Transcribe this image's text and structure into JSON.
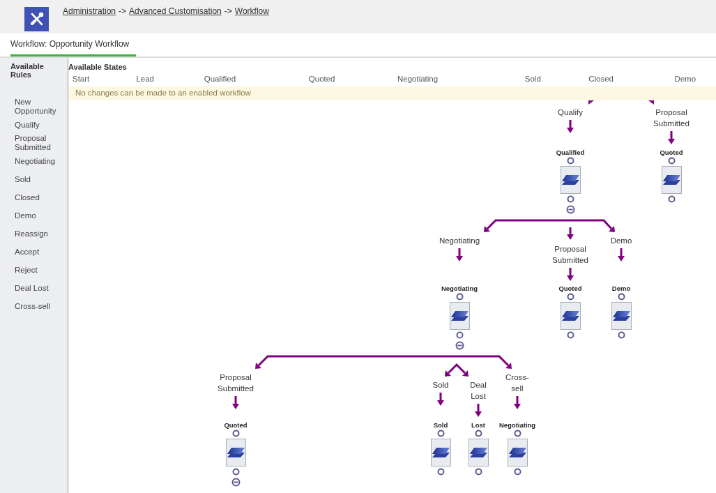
{
  "breadcrumb": [
    {
      "kind": "link",
      "text": "Administration"
    },
    {
      "kind": "separator",
      "text": "->"
    },
    {
      "kind": "link",
      "text": "Advanced Customisation"
    },
    {
      "kind": "separator",
      "text": "->"
    },
    {
      "kind": "link",
      "text": "Workflow"
    }
  ],
  "tab": {
    "title": "Workflow: Opportunity Workflow",
    "selected": true
  },
  "rules_panel": {
    "title": "Available Rules",
    "items": [
      "New Opportunity",
      "Qualify",
      "Proposal Submitted",
      "Negotiating",
      "Sold",
      "Closed",
      "Demo",
      "Reassign",
      "Accept",
      "Reject",
      "Deal Lost",
      "Cross-sell"
    ]
  },
  "states_header": {
    "title": "Available States",
    "columns": [
      "Start",
      "Lead",
      "Qualified",
      "Quoted",
      "Negotiating",
      "Sold",
      "Closed",
      "Demo"
    ]
  },
  "notice": "No changes can be made to an enabled workflow",
  "diagram": {
    "nodes": [
      {
        "rule": "Qualify",
        "state": "Qualified",
        "expanded": true
      },
      {
        "rule": "Proposal Submitted",
        "state": "Quoted",
        "expanded": false
      },
      {
        "rule": "Negotiating",
        "state": "Negotiating",
        "expanded": true
      },
      {
        "rule": "Proposal Submitted",
        "state": "Quoted",
        "expanded": false
      },
      {
        "rule": "Demo",
        "state": "Demo",
        "expanded": false
      },
      {
        "rule": "Proposal Submitted",
        "state": "Quoted",
        "expanded": true
      },
      {
        "rule": "Sold",
        "state": "Sold",
        "expanded": false
      },
      {
        "rule": "Deal Lost",
        "state": "Lost",
        "expanded": false
      },
      {
        "rule": "Cross-sell",
        "state": "Negotiating",
        "expanded": false
      }
    ]
  }
}
